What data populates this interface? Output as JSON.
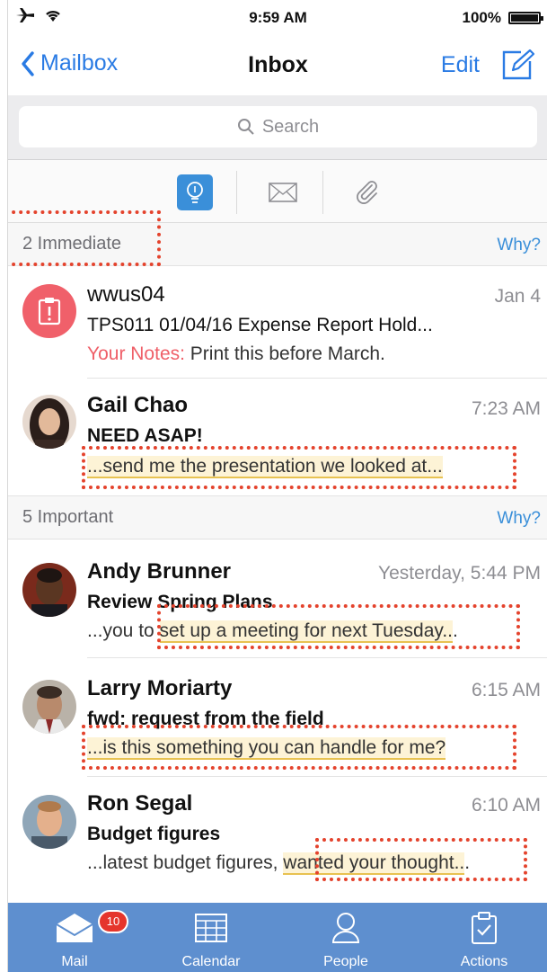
{
  "status": {
    "time": "9:59 AM",
    "battery": "100%"
  },
  "nav": {
    "back": "Mailbox",
    "title": "Inbox",
    "edit": "Edit"
  },
  "search": {
    "placeholder": "Search"
  },
  "sections": [
    {
      "label": "2 Immediate",
      "why": "Why?"
    },
    {
      "label": "5 Important",
      "why": "Why?"
    }
  ],
  "messages": [
    {
      "sender": "wwus04",
      "time": "Jan 4",
      "subject": "TPS011 01/04/16 Expense Report Hold...",
      "notes_label": "Your Notes:",
      "preview": " Print this before March.",
      "avatar": "clipboard-alert-icon",
      "avatar_color": "#f0606a"
    },
    {
      "sender": "Gail Chao",
      "time": "7:23 AM",
      "subject": "NEED ASAP!",
      "preview_pre": "",
      "preview_hl": "...send me the presentation we looked at...",
      "preview_post": ""
    },
    {
      "sender": "Andy Brunner",
      "time": "Yesterday, 5:44 PM",
      "subject": "Review Spring Plans",
      "preview_pre": "...you to ",
      "preview_hl": "set up a meeting for next Tuesday..",
      "preview_post": "."
    },
    {
      "sender": "Larry Moriarty",
      "time": "6:15 AM",
      "subject": "fwd: request from the field",
      "preview_pre": "",
      "preview_hl": "...is this something you can handle for me?",
      "preview_post": ""
    },
    {
      "sender": "Ron Segal",
      "time": "6:10 AM",
      "subject": "Budget figures",
      "preview_pre": "...latest budget figures, ",
      "preview_hl": "wanted your thought..",
      "preview_post": "."
    }
  ],
  "tabs": [
    {
      "label": "Mail",
      "badge": "10"
    },
    {
      "label": "Calendar"
    },
    {
      "label": "People"
    },
    {
      "label": "Actions"
    }
  ],
  "colors": {
    "accent": "#2a7be4",
    "tabbar": "#5e8fcf",
    "highlight_box": "#e4432d",
    "notes": "#ef5f68"
  }
}
